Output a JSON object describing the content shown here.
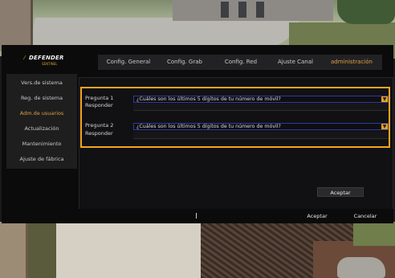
{
  "brand": {
    "name": "DEFENDER",
    "tagline": "SENTINEL"
  },
  "tabs": [
    {
      "label": "Config. General",
      "active": false
    },
    {
      "label": "Config. Grab",
      "active": false
    },
    {
      "label": "Config. Red",
      "active": false
    },
    {
      "label": "Ajuste Canal",
      "active": false
    },
    {
      "label": "administración",
      "active": true
    }
  ],
  "sidebar": {
    "items": [
      {
        "label": "Vers.de sistema",
        "active": false
      },
      {
        "label": "Reg. de sistema",
        "active": false
      },
      {
        "label": "Adm.de usuarios",
        "active": true
      },
      {
        "label": "Actualización",
        "active": false
      },
      {
        "label": "Mantenimiento",
        "active": false
      },
      {
        "label": "Ajuste de fábrica",
        "active": false
      }
    ]
  },
  "security": {
    "q1_label": "Pregunta 1",
    "q1_value": "¿Cuáles son los últimos 5 dígitos de tu número de móvil?",
    "a1_label": "Responder",
    "a1_value": "",
    "q2_label": "Pregunta 2",
    "q2_value": "¿Cuáles son los últimos 5 dígitos de tu número de móvil?",
    "a2_label": "Responder",
    "a2_value": ""
  },
  "buttons": {
    "inner_accept": "Aceptar",
    "accept": "Aceptar",
    "cancel": "Cancelar"
  },
  "colors": {
    "accent": "#f2a520",
    "active_text": "#e0a040",
    "panel": "#0b0b0b"
  }
}
